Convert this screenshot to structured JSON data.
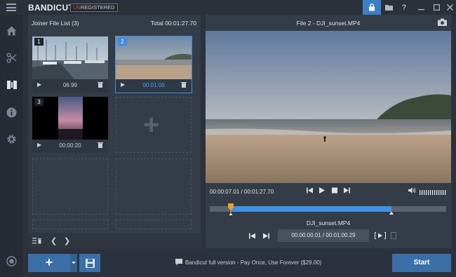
{
  "app": {
    "brand": "BANDICUT",
    "badge_prefix": "UN",
    "badge_rest": "REGISTERED"
  },
  "joiner": {
    "title": "Joiner File List (3)",
    "total": "Total 00:01:27.70",
    "tiles": [
      {
        "num": "1",
        "duration": "06.99"
      },
      {
        "num": "2",
        "duration": "00:01:00"
      },
      {
        "num": "3",
        "duration": "00:00:20"
      }
    ]
  },
  "player": {
    "title": "File 2 - DJI_sunset.MP4",
    "time_readout": "00:00:07.01 / 00:01:27.70",
    "filename": "DJI_sunset.MP4",
    "segment_time": "00:00:00.01 / 00:01:00.29",
    "progress": 0.09,
    "segment_start": 0.09,
    "segment_end": 0.77
  },
  "bottom": {
    "add_label": "+",
    "promo": "Bandicut full version - Pay Once, Use Forever ($29.00)",
    "start_label": "Start"
  },
  "colors": {
    "accent": "#3f8de0",
    "button": "#3b6fa8",
    "badge_red": "#e04545"
  }
}
